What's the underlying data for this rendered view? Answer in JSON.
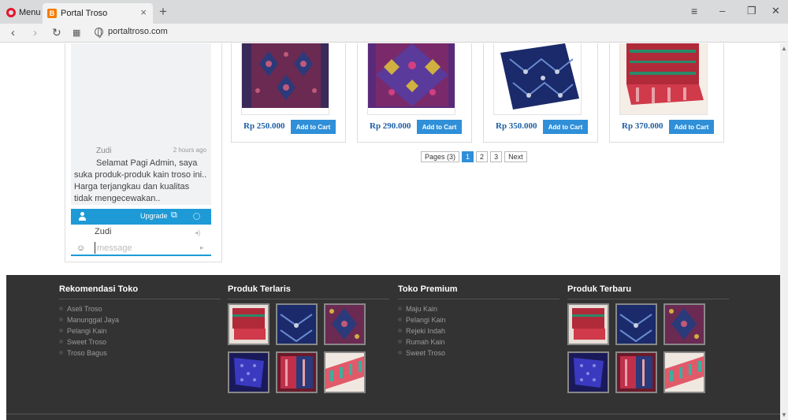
{
  "browser": {
    "menu_label": "Menu",
    "tab_title": "Portal Troso",
    "tab_close": "×",
    "new_tab": "+",
    "url": "portaltroso.com",
    "min": "–",
    "max": "❐",
    "close": "✕"
  },
  "chat": {
    "user": "Zudi",
    "time": "2 hours ago",
    "message": "Selamat Pagi Admin, saya suka produk-produk kain troso ini.. Harga terjangkau dan kualitas tidak mengecewakan..",
    "upgrade_label": "Upgrade",
    "current_user": "Zudi",
    "input_placeholder": "message"
  },
  "products": [
    {
      "price": "Rp 250.000",
      "cart_label": "Add to Cart",
      "colors": [
        "#7a2a52",
        "#2b3a7a",
        "#c05a7a"
      ]
    },
    {
      "price": "Rp 290.000",
      "cart_label": "Add to Cart",
      "colors": [
        "#8a2a6a",
        "#5a3a9a",
        "#d0b040"
      ]
    },
    {
      "price": "Rp 350.000",
      "cart_label": "Add to Cart",
      "colors": [
        "#1a2a6a",
        "#4a6ac0",
        "#c8d0e0"
      ]
    },
    {
      "price": "Rp 370.000",
      "cart_label": "Add to Cart",
      "colors": [
        "#c02a3a",
        "#2a8a6a",
        "#e0d0c0"
      ]
    }
  ],
  "pagination": {
    "summary": "Pages (3)",
    "pages": [
      "1",
      "2",
      "3"
    ],
    "active_page": "1",
    "next": "Next"
  },
  "footer": {
    "rekomendasi": {
      "title": "Rekomendasi Toko",
      "items": [
        "Aseli Troso",
        "Manunggal Jaya",
        "Pelangi Kain",
        "Sweet Troso",
        "Troso Bagus"
      ]
    },
    "terlaris": {
      "title": "Produk Terlaris"
    },
    "premium": {
      "title": "Toko Premium",
      "items": [
        "Maju Kain",
        "Pelangi Kain",
        "Rejeki Indah",
        "Rumah Kain",
        "Sweet Troso"
      ]
    },
    "terbaru": {
      "title": "Produk Terbaru"
    }
  }
}
